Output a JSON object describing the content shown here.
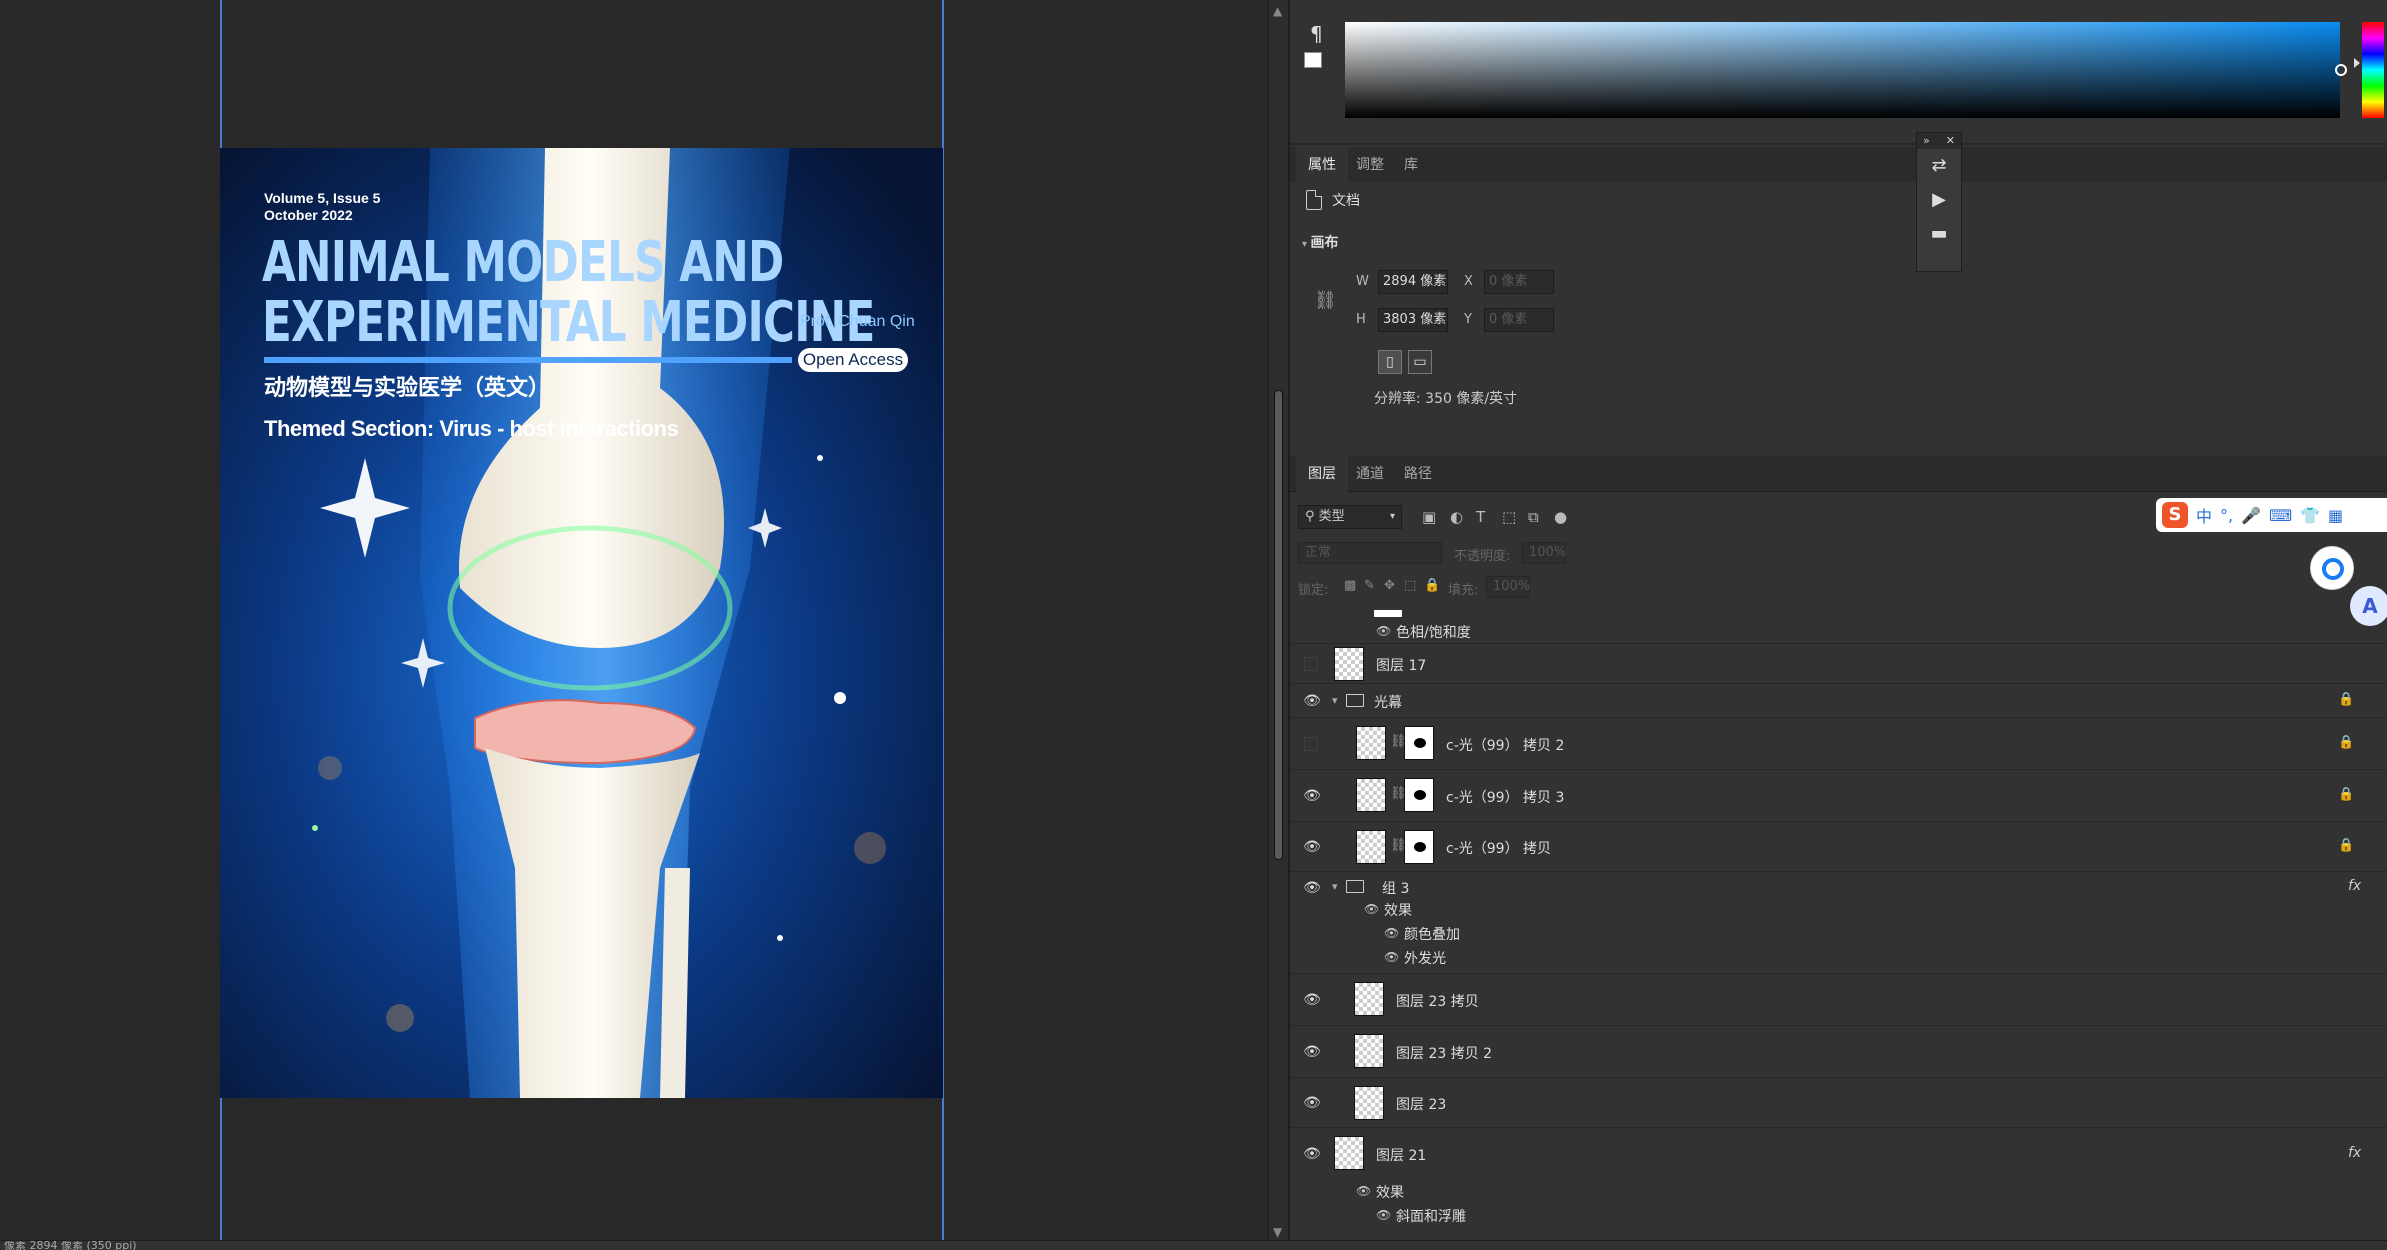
{
  "canvas": {
    "cover": {
      "volume": "Volume 5, Issue 5",
      "date": "October 2022",
      "title_line1": "ANIMAL MODELS AND",
      "title_line2": "EXPERIMENTAL MEDICINE",
      "editor": "Prof. Chuan Qin",
      "open_access": "Open Access",
      "chinese_title": "动物模型与实验医学（英文）",
      "themed_section": "Themed Section: Virus - host interactions"
    }
  },
  "status_bar": {
    "text": "像素 2894 像素 (350 ppi)"
  },
  "colors": {
    "guide": "#4a79d6",
    "gradient_hue": "#0a8cf0",
    "panel_bg": "#323232"
  },
  "mini_toolbar": {
    "collapse": "»",
    "close": "✕"
  },
  "properties": {
    "tabs": [
      "属性",
      "调整",
      "库"
    ],
    "doc_label": "文档",
    "section": "画布",
    "width_label": "W",
    "width_value": "2894 像素",
    "height_label": "H",
    "height_value": "3803 像素",
    "x_label": "X",
    "x_value": "0 像素",
    "y_label": "Y",
    "y_value": "0 像素",
    "resolution": "分辨率: 350 像素/英寸"
  },
  "layers": {
    "tabs": [
      "图层",
      "通道",
      "路径"
    ],
    "kind": "类型",
    "blend_mode": "正常",
    "opacity_label": "不透明度:",
    "opacity_value": "100%",
    "lock_label": "锁定:",
    "fill_label": "填充:",
    "fill_value": "100%",
    "items": {
      "hue_sat": "色相/饱和度",
      "layer17": "图层 17",
      "group_light": "光幕",
      "c_light_copy2": "c-光（99） 拷贝 2",
      "c_light_copy3": "c-光（99） 拷贝 3",
      "c_light_copy": "c-光（99） 拷贝",
      "group3": "组 3",
      "effects": "效果",
      "color_overlay": "颜色叠加",
      "outer_glow": "外发光",
      "layer23_copy": "图层 23 拷贝",
      "layer23_copy2": "图层 23 拷贝 2",
      "layer23": "图层 23",
      "layer21": "图层 21",
      "effects2": "效果",
      "bevel": "斜面和浮雕"
    }
  },
  "ime": {
    "logo": "S",
    "lang": "中",
    "punct": "°,",
    "mic": "🎤",
    "keyboard": "⌨",
    "skin": "👕",
    "grid": "▦"
  }
}
